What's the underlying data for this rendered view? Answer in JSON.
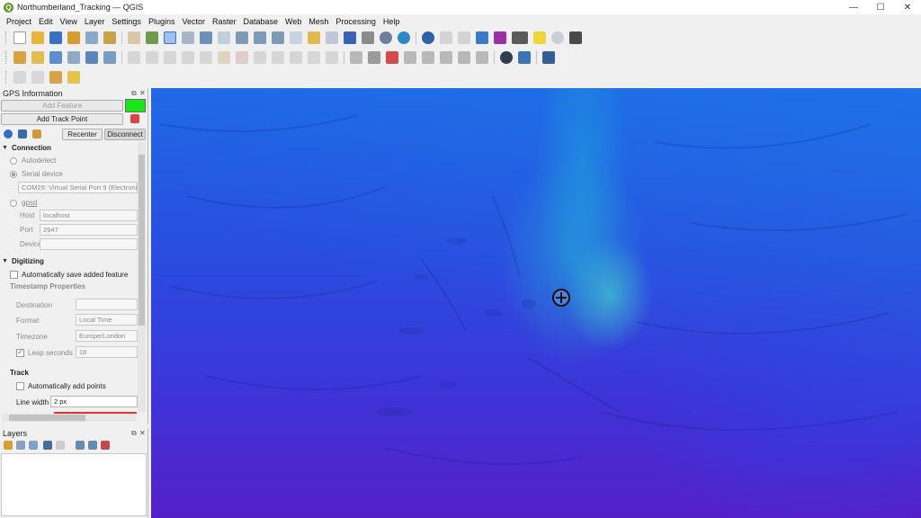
{
  "window": {
    "title": "Northumberland_Tracking — QGIS",
    "app_logo_letter": "Q"
  },
  "window_controls": {
    "minimize": "—",
    "maximize": "☐",
    "close": "✕"
  },
  "menubar": {
    "items": [
      "Project",
      "Edit",
      "View",
      "Layer",
      "Settings",
      "Plugins",
      "Vector",
      "Raster",
      "Database",
      "Web",
      "Mesh",
      "Processing",
      "Help"
    ]
  },
  "gps_panel": {
    "title": "GPS Information",
    "add_feature_label": "Add Feature",
    "add_track_point_label": "Add Track Point",
    "recenter_label": "Recenter",
    "disconnect_label": "Disconnect",
    "swatch_color": "#17e617",
    "connection": {
      "header": "Connection",
      "autodetect_label": "Autodetect",
      "serial_device_label": "Serial device",
      "serial_port_value": "COM29: Virtual Serial Port 9 (Electroni",
      "gpsd_label": "gpsd",
      "host_label": "Host",
      "host_value": "localhost",
      "port_label": "Port",
      "port_value": "2947",
      "device_label": "Device",
      "device_value": ""
    },
    "digitizing": {
      "header": "Digitizing",
      "auto_save_label": "Automatically save added feature",
      "timestamp_header": "Timestamp Properties",
      "destination_label": "Destination",
      "destination_value": "",
      "format_label": "Format",
      "format_value": "Local Time",
      "timezone_label": "Timezone",
      "timezone_value": "Europe/London",
      "leap_seconds_label": "Leap seconds",
      "leap_seconds_value": "18"
    },
    "track": {
      "header": "Track",
      "auto_add_points_label": "Automatically add points",
      "line_width_label": "Line width",
      "line_width_value": "2 px"
    }
  },
  "layers_panel": {
    "title": "Layers"
  },
  "colors": {
    "map_top": "#2066e6",
    "map_bottom": "#5520c9",
    "shoal_highlight": "#48e6c8"
  }
}
